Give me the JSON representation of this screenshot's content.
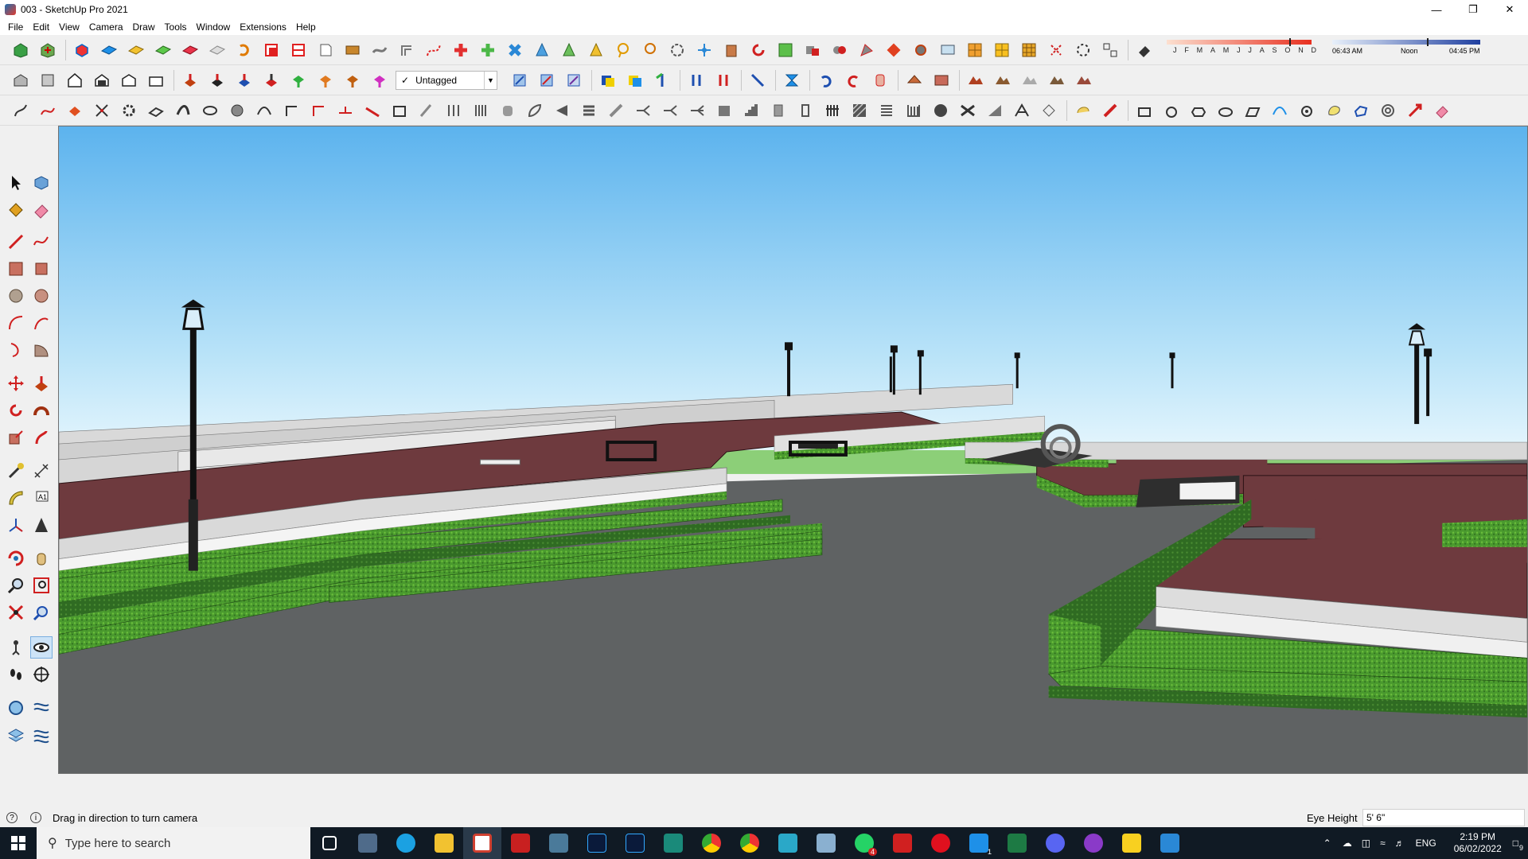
{
  "window": {
    "title": "003 - SketchUp Pro 2021",
    "controls": [
      "minimize",
      "restore",
      "close"
    ]
  },
  "menu": [
    "File",
    "Edit",
    "View",
    "Camera",
    "Draw",
    "Tools",
    "Window",
    "Extensions",
    "Help"
  ],
  "toolbar": {
    "tag_selected": "Untagged",
    "tag_checkmark": "✓"
  },
  "shadows": {
    "months": [
      "J",
      "F",
      "M",
      "A",
      "M",
      "J",
      "J",
      "A",
      "S",
      "O",
      "N",
      "D"
    ],
    "time_start": "06:43 AM",
    "time_mid": "Noon",
    "time_end": "04:45 PM"
  },
  "status": {
    "message": "Drag in direction to turn camera",
    "measurement_label": "Eye Height",
    "measurement_value": "5' 6\""
  },
  "taskbar": {
    "search_placeholder": "Type here to search",
    "language": "ENG",
    "time": "2:19 PM",
    "date": "06/02/2022",
    "notification_count": "9",
    "whatsapp_badge": "4",
    "vscode_badge": "1"
  },
  "colors": {
    "sky_top": "#5cb3ee",
    "sky_horizon": "#e6f6fd",
    "ground_far": "#8ccf78",
    "road": "#5f6263",
    "plaza": "#6e3a3e",
    "grass": "#3d7f2a",
    "steps": "#d9d9d9",
    "taskbar": "#101a24"
  }
}
